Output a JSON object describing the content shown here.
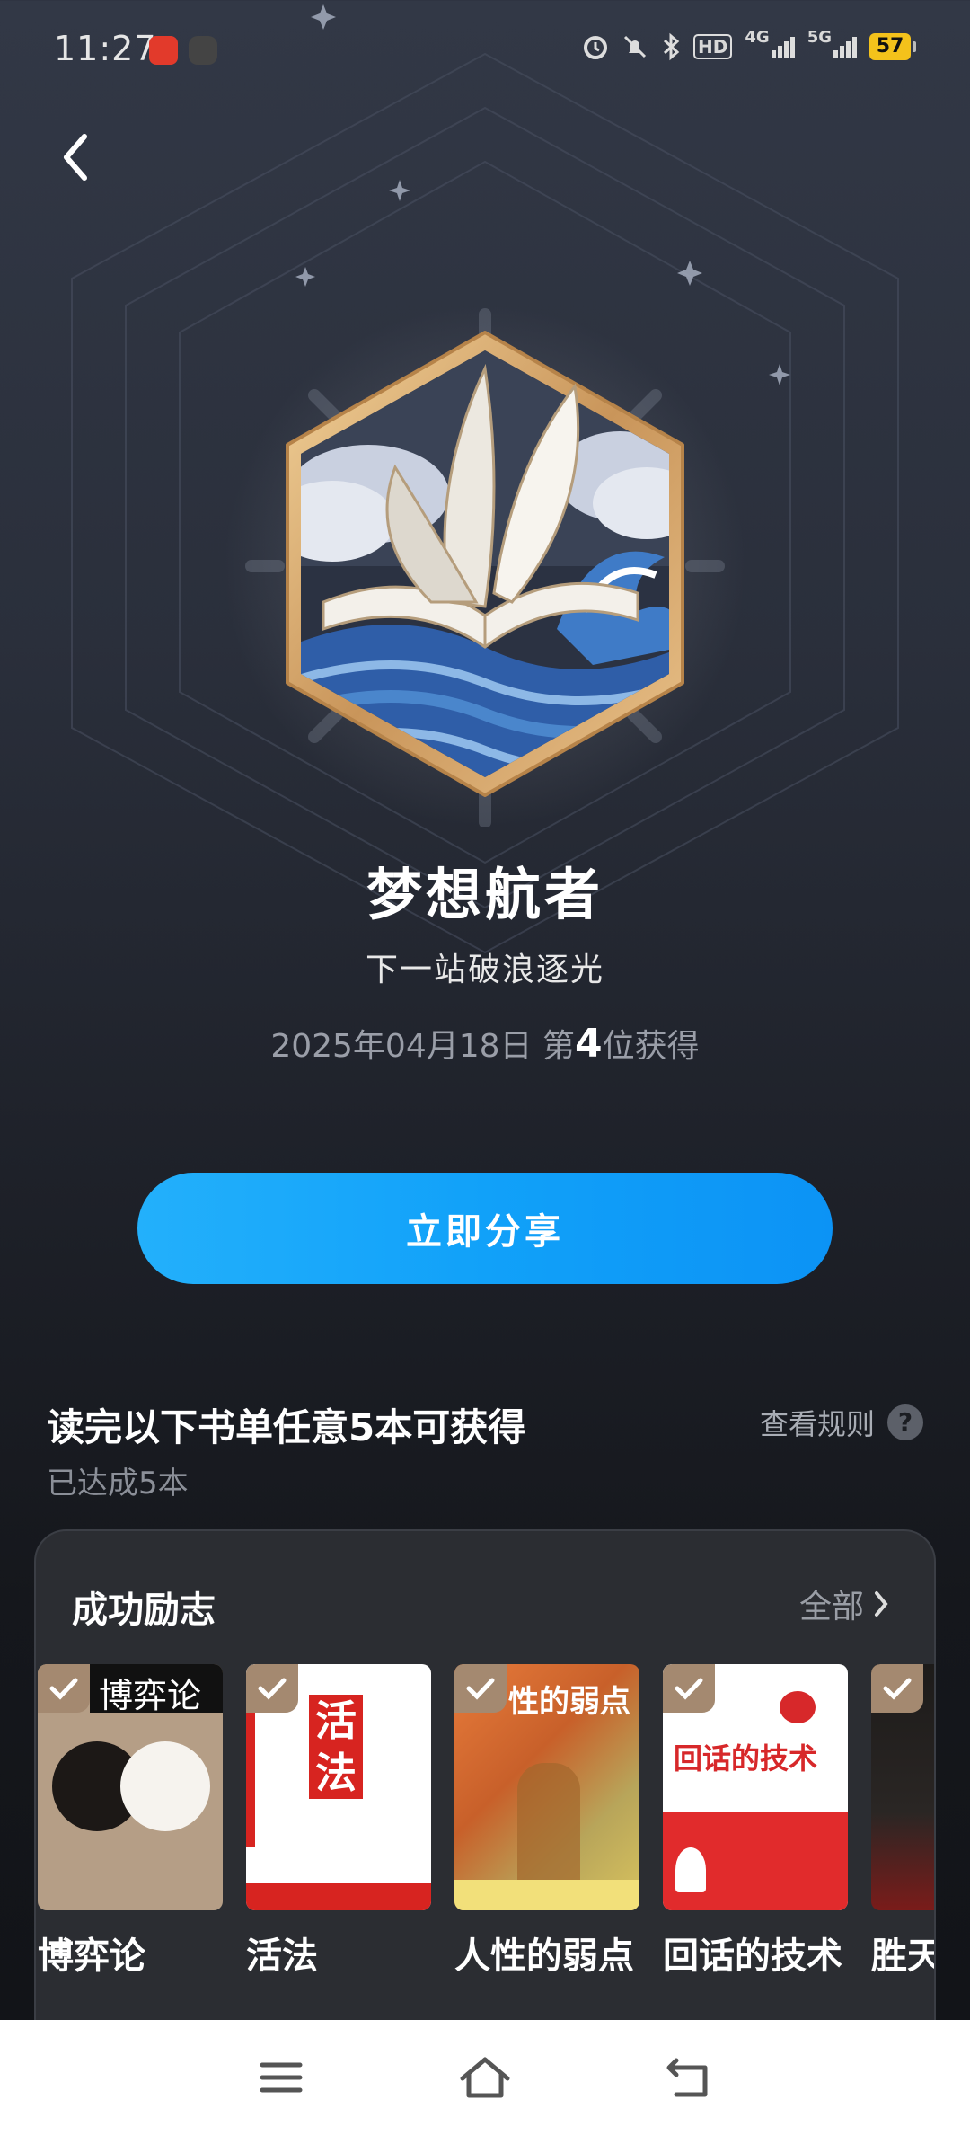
{
  "status_bar": {
    "time": "11:27",
    "network_hd": "HD",
    "network_4g": "4G",
    "network_5g": "5G",
    "battery": "57",
    "icons": [
      "alarm-icon",
      "mute-icon",
      "bluetooth-icon",
      "hd-icon",
      "signal-4g-icon",
      "signal-5g-icon",
      "battery-icon"
    ]
  },
  "header": {
    "back_icon": "chevron-left-icon"
  },
  "badge": {
    "title": "梦想航者",
    "subtitle": "下一站破浪逐光",
    "date": "2025年04月18日",
    "rank_prefix": "第",
    "rank": "4",
    "rank_suffix": "位获得"
  },
  "share_button": {
    "label": "立即分享"
  },
  "task": {
    "title": "读完以下书单任意5本可获得",
    "progress": "已达成5本",
    "rules_label": "查看规则",
    "rules_icon": "?"
  },
  "booklist": {
    "title": "成功励志",
    "all_label": "全部",
    "books": [
      {
        "name": "博弈论",
        "cover_text": "博弈论",
        "read": true
      },
      {
        "name": "活法",
        "cover_text": "活法",
        "read": true
      },
      {
        "name": "人性的弱点",
        "cover_text": "性的弱点",
        "read": true
      },
      {
        "name": "回话的技术",
        "cover_text": "回话的技术",
        "read": true
      },
      {
        "name": "胜天",
        "cover_text": "",
        "read": true
      }
    ]
  },
  "colors": {
    "accent": "#11a1f9",
    "check_badge": "#a48970",
    "gold": "#d7a86a"
  },
  "nav": {
    "items": [
      "menu-icon",
      "home-icon",
      "back-icon"
    ]
  }
}
